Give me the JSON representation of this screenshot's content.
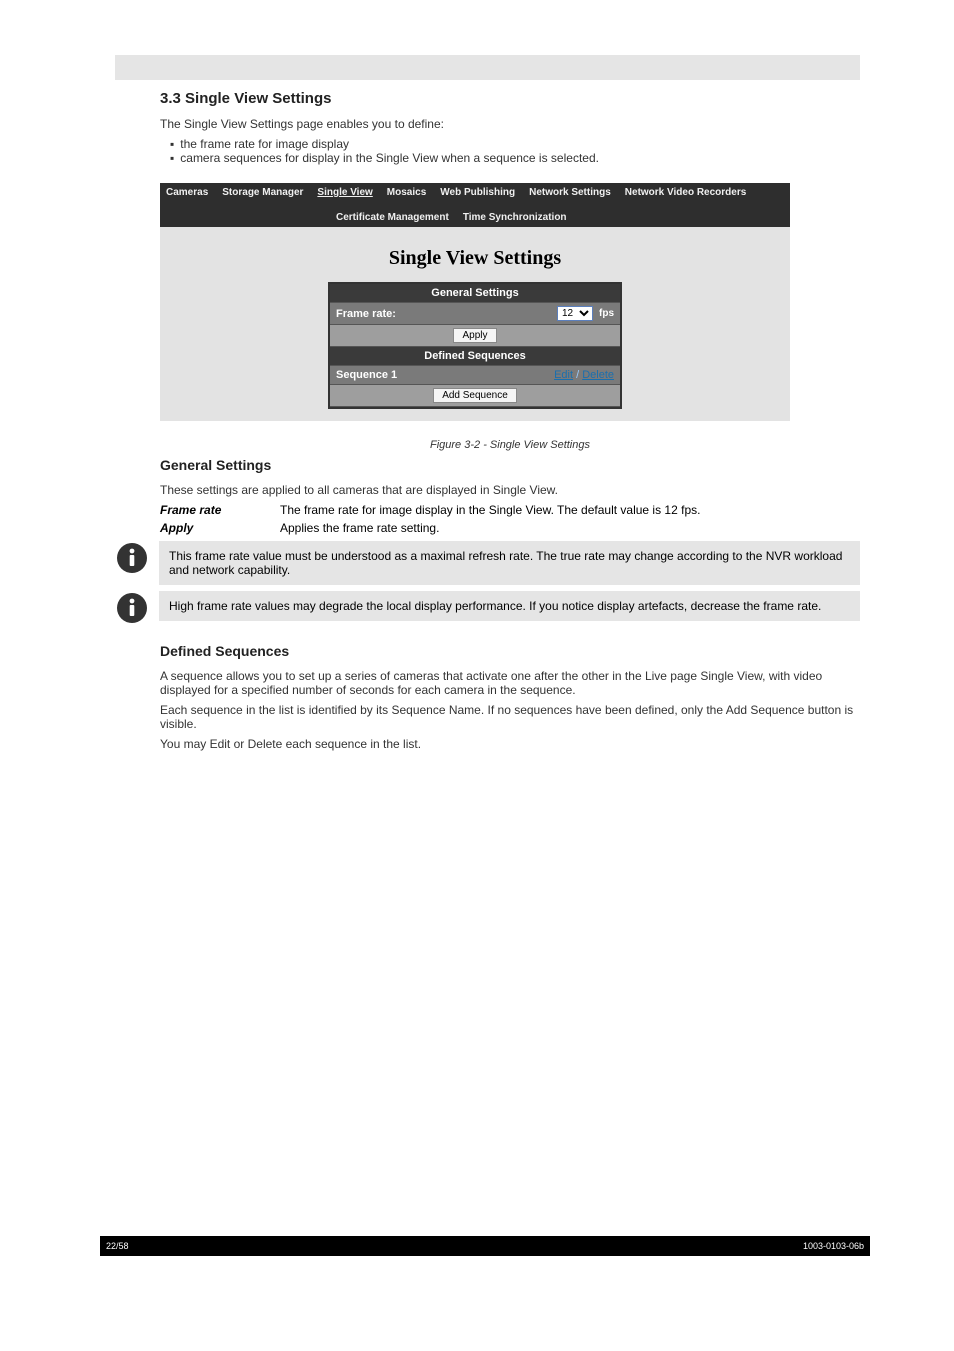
{
  "header": {},
  "section": {
    "title": "3.3 Single View Settings",
    "intro": "The Single View Settings page enables you to define:",
    "bullets": [
      "the frame rate for image display",
      "camera sequences for display in the Single View when a sequence is selected."
    ]
  },
  "screenshot": {
    "nav": {
      "items": [
        "Cameras",
        "Storage Manager",
        "Single View",
        "Mosaics",
        "Web Publishing",
        "Network Settings",
        "Network Video Recorders"
      ],
      "items2": [
        "Certificate Management",
        "Time Synchronization"
      ],
      "active": "Single View"
    },
    "panel_title": "Single View Settings",
    "general": {
      "header": "General Settings",
      "frame_rate_label": "Frame rate:",
      "frame_rate_value": "12",
      "fps_unit": "fps",
      "apply": "Apply"
    },
    "sequences": {
      "header": "Defined Sequences",
      "row_label": "Sequence 1",
      "edit": "Edit",
      "sep": " / ",
      "delete": "Delete",
      "add": "Add Sequence"
    },
    "caption": "Figure 3-2 - Single View Settings"
  },
  "general_section": {
    "title": "General Settings",
    "intro": "These settings are applied to all cameras that are displayed in Single View.",
    "frame_rate_label": "Frame rate",
    "frame_rate_text": "The frame rate for image display in the Single View. The default value is 12 fps.",
    "apply_label": "Apply",
    "apply_text": "Applies the frame rate setting."
  },
  "notes": {
    "note1": "This frame rate value must be understood as a maximal refresh rate. The true rate may change according to the NVR workload and network capability.",
    "note2": "High frame rate values may degrade the local display performance. If you notice display artefacts, decrease the frame rate."
  },
  "defined_section": {
    "title": "Defined Sequences",
    "para1": "A sequence allows you to set up a series of cameras that activate one after the other in the Live page Single View, with video displayed for a specified number of seconds for each camera in the sequence.",
    "para2": "Each sequence in the list is identified by its Sequence Name. If no sequences have been defined, only the Add Sequence button is visible.",
    "para3": "You may Edit or Delete each sequence in the list."
  },
  "footer": {
    "page": "22/58",
    "docref": "1003-0103-06b"
  }
}
